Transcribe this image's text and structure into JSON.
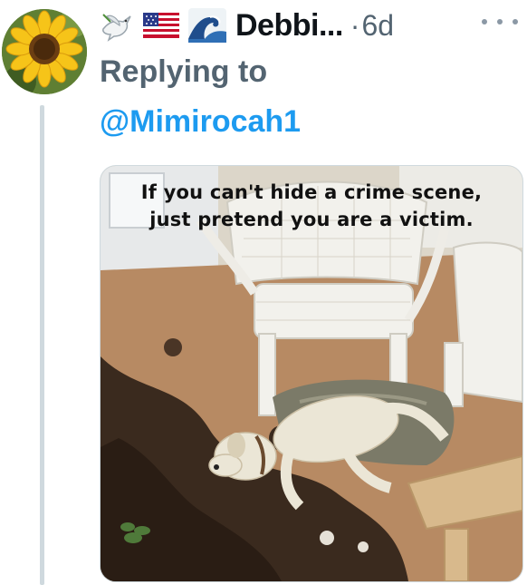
{
  "tweet": {
    "display_name": "Debbi...",
    "separator": "·",
    "timestamp": "6d",
    "replying_label": "Replying to",
    "replying_to": "@Mimirocah1",
    "emojis": [
      "dove-emoji",
      "us-flag-emoji",
      "wave-emoji"
    ],
    "avatar": "sunflower-avatar"
  },
  "media": {
    "caption_line1": "If you can't hide a crime scene,",
    "caption_line2": "just pretend you are a victim."
  },
  "colors": {
    "name": "#0f1419",
    "muted": "#536471",
    "link": "#1d9bf0",
    "thread_line": "#cfd9de"
  }
}
